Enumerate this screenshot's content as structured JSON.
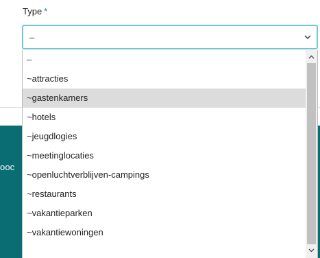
{
  "background": {
    "partial_text": "ooc",
    "colors": {
      "teal": "#0b6d74",
      "divider": "#dcdcdc"
    }
  },
  "field": {
    "label": "Type",
    "required_marker": "*",
    "selected_value": "–",
    "chevron_icon": "chevron-down-icon",
    "colors": {
      "focus_border": "#6fc7d6",
      "required": "#1a7f8c"
    }
  },
  "dropdown": {
    "highlighted_index": 2,
    "options": [
      {
        "label": "–"
      },
      {
        "label": "~attracties"
      },
      {
        "label": "~gastenkamers"
      },
      {
        "label": "~hotels"
      },
      {
        "label": "~jeugdlogies"
      },
      {
        "label": "~meetinglocaties"
      },
      {
        "label": "~openluchtverblijven-campings"
      },
      {
        "label": "~restaurants"
      },
      {
        "label": "~vakantieparken"
      },
      {
        "label": "~vakantiewoningen"
      }
    ],
    "scroll_position": 0,
    "scroll_visible_fraction": 0.9,
    "colors": {
      "highlight": "#dcdcdc",
      "scroll_track": "#f0f0f0",
      "scroll_thumb": "#c1c1c1"
    }
  }
}
